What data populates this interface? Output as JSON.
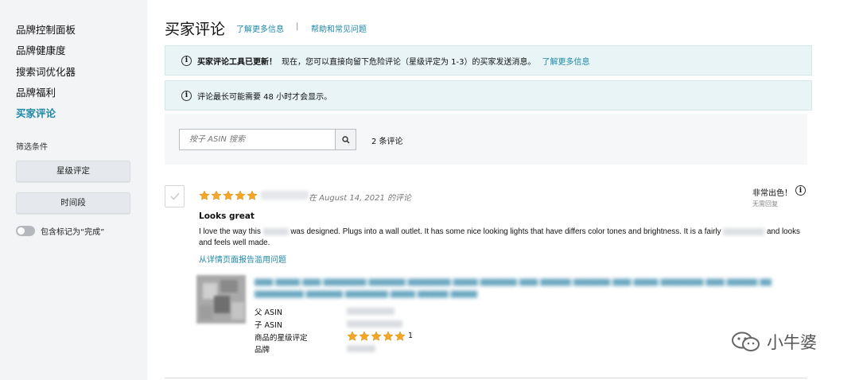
{
  "sidebar": {
    "items": [
      {
        "label": "品牌控制面板",
        "active": false
      },
      {
        "label": "品牌健康度",
        "active": false
      },
      {
        "label": "搜索词优化器",
        "active": false
      },
      {
        "label": "品牌福利",
        "active": false
      },
      {
        "label": "买家评论",
        "active": true
      }
    ],
    "filter_title": "筛选条件",
    "filter_buttons": [
      "星级评定",
      "时间段"
    ],
    "toggle_label": "包含标记为“完成”",
    "toggle_on": false
  },
  "header": {
    "title": "买家评论",
    "learn_more": "了解更多信息",
    "separator": "|",
    "help": "帮助和常见问题"
  },
  "alerts": [
    {
      "strong": "买家评论工具已更新！",
      "text": "现在，您可以直接向留下危险评论（星级评定为 1-3）的买家发送消息。",
      "link": "了解更多信息"
    },
    {
      "text": "评论最长可能需要 48 小时才会显示。"
    }
  ],
  "search": {
    "placeholder": "按子 ASIN 搜索",
    "count": "2 条评论"
  },
  "review": {
    "stars": 5,
    "date": "在 August 14, 2021 的评论",
    "rating_label": "非常出色！",
    "reply_status": "无需回复",
    "title": "Looks great",
    "body_part1": "I love the way this",
    "body_part2": "was designed. Plugs into a wall outlet. It has some nice looking lights that have differs color tones and brightness. It is a fairly",
    "body_part3": "and looks and feels well made.",
    "report_link": "从详情页面报告滥用问题"
  },
  "product": {
    "labels": [
      "父 ASIN",
      "子 ASIN",
      "商品的星级评定",
      "品牌"
    ],
    "stars": 5,
    "rating_count": "1"
  },
  "watermark": {
    "text": "小牛婆"
  },
  "colors": {
    "accent": "#1e88a8",
    "star": "#f5a623",
    "alert_bg": "#e8f4f6",
    "sidebar_bg": "#f3f4f6"
  }
}
